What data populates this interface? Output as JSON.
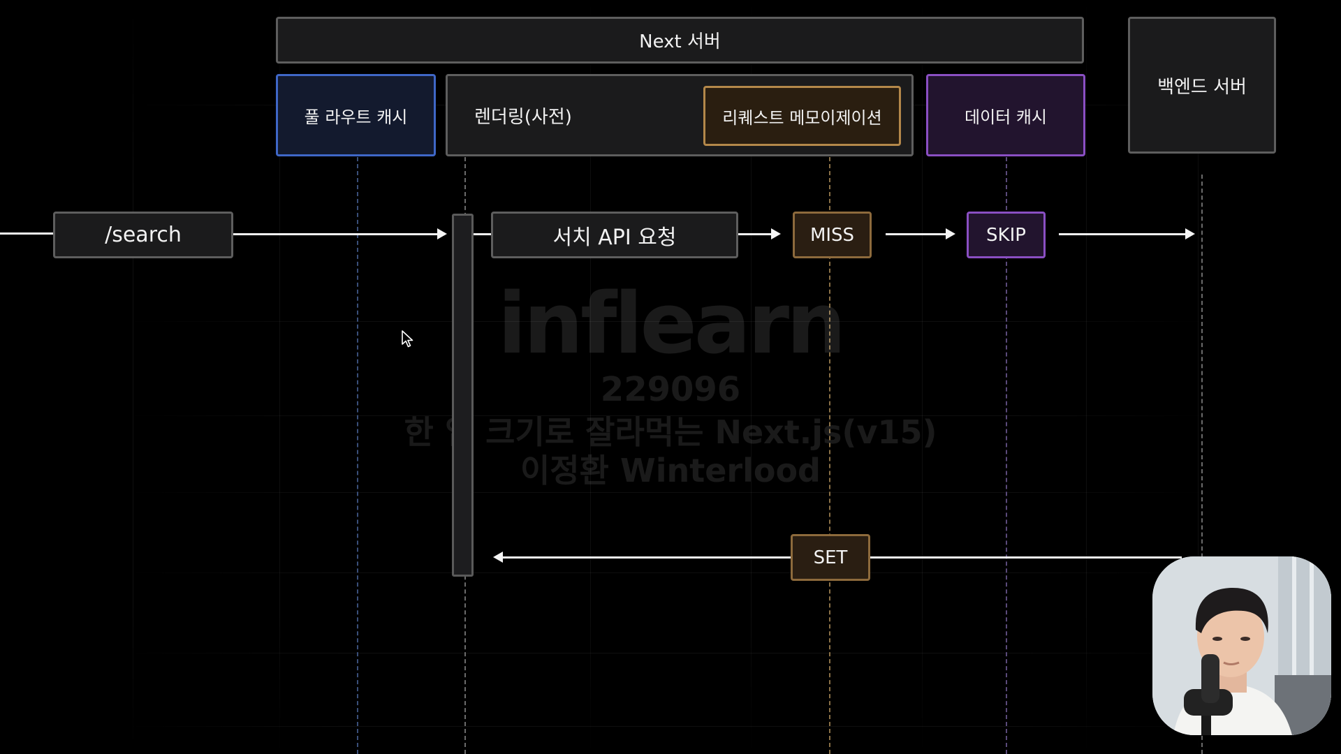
{
  "header": {
    "next_server": "Next 서버",
    "backend_server": "백엔드 서버"
  },
  "columns": {
    "full_route_cache": "풀 라우트 캐시",
    "rendering": "렌더링(사전)",
    "request_memoization": "리퀘스트 메모이제이션",
    "data_cache": "데이터 캐시"
  },
  "flow": {
    "route": "/search",
    "api_request": "서치 API 요청",
    "miss": "MISS",
    "skip": "SKIP",
    "set": "SET"
  },
  "watermark": {
    "brand": "inflearn",
    "id": "229096",
    "course": "한 입 크기로 잘라먹는 Next.js(v15)",
    "author": "이정환 Winterlood"
  },
  "colors": {
    "background": "#000000",
    "neutral_border": "#5e5e5e",
    "full_route_cache_border": "#3f67c7",
    "data_cache_border": "#8a4fc3",
    "memoization_border": "#b4884a",
    "lifeline_blue": "#3a4f7a",
    "lifeline_gray": "#6b6b6b",
    "lifeline_gold": "#8a7046",
    "lifeline_purple": "#5a4a7a"
  },
  "icons": {
    "cursor": "mouse-pointer-icon",
    "presenter": "presenter-webcam"
  }
}
